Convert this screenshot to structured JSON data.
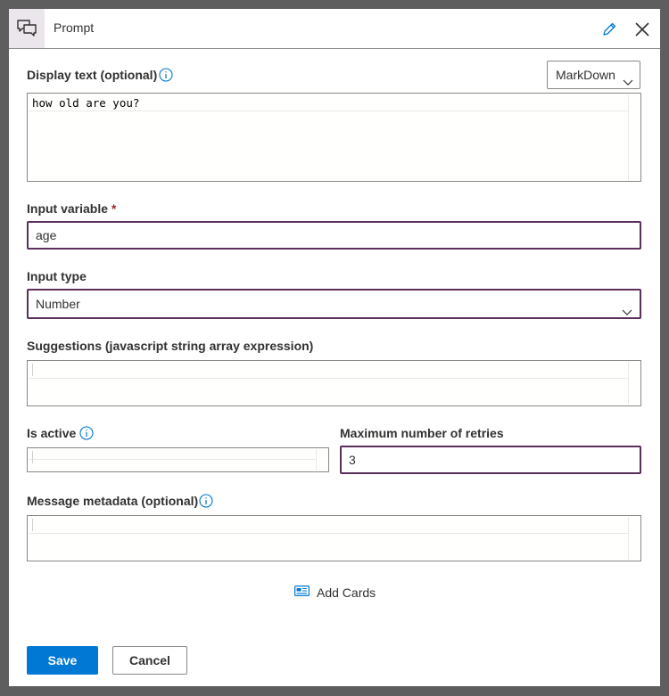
{
  "header": {
    "title": "Prompt",
    "icon": "chat-bubbles-icon",
    "edit_icon": "pencil-icon",
    "close_icon": "close-icon"
  },
  "display_text": {
    "label": "Display text (optional)",
    "format_value": "MarkDown",
    "value": "how old are you?"
  },
  "input_variable": {
    "label": "Input variable",
    "required_mark": "*",
    "value": "age"
  },
  "input_type": {
    "label": "Input type",
    "value": "Number"
  },
  "suggestions": {
    "label": "Suggestions (javascript string array expression)",
    "value": ""
  },
  "is_active": {
    "label": "Is active",
    "value": ""
  },
  "max_retries": {
    "label": "Maximum number of retries",
    "value": "3"
  },
  "message_metadata": {
    "label": "Message metadata (optional)",
    "value": ""
  },
  "add_cards": {
    "label": "Add Cards",
    "icon": "card-icon"
  },
  "footer": {
    "save_label": "Save",
    "cancel_label": "Cancel"
  },
  "colors": {
    "primary": "#0078d4",
    "focus_border": "#5c2e5c",
    "required": "#a4262c",
    "info_icon": "#0078d4",
    "header_icon_bg": "#ebe6ec"
  }
}
